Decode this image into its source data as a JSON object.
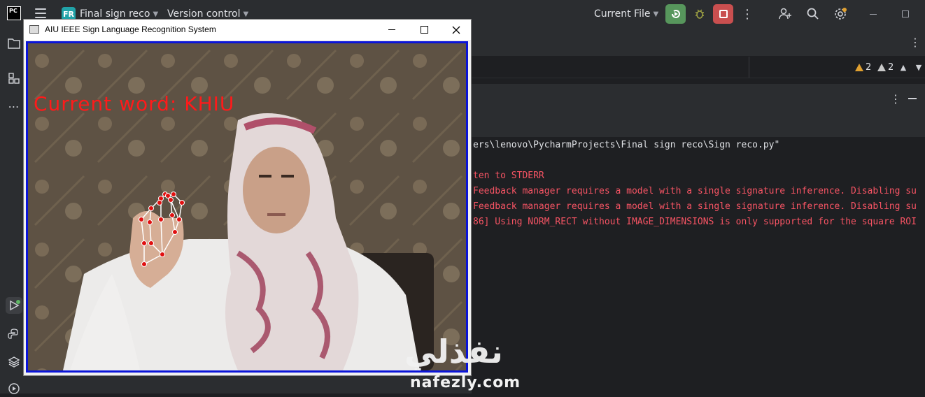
{
  "topbar": {
    "app_logo": "PC",
    "project_badge": "FR",
    "project_name": "Final sign reco",
    "vcs_menu": "Version control",
    "run_config": "Current File"
  },
  "editor": {
    "warnings_1": "2",
    "warnings_2": "2"
  },
  "console": {
    "lines": [
      "ers\\lenovo\\PycharmProjects\\Final sign reco\\Sign reco.py\"",
      "ten to STDERR",
      "Feedback manager requires a model with a single signature inference. Disabling su",
      "Feedback manager requires a model with a single signature inference. Disabling su",
      "86] Using NORM_RECT without IMAGE_DIMENSIONS is only supported for the square ROI"
    ],
    "colors": {
      "path": "#dfe1e5",
      "error": "#f75464"
    }
  },
  "cv_window": {
    "title": "AIU IEEE Sign Language Recognition System",
    "overlay_text": "Current word: KHIU"
  },
  "watermark": {
    "arabic": "نفذلي",
    "latin": "nafezly.com"
  },
  "icons": [
    "folder-icon",
    "structure-icon",
    "more-icon",
    "run-tool-icon",
    "python-console-icon",
    "layers-icon",
    "services-icon",
    "debug-icon",
    "add-user-icon",
    "search-icon",
    "settings-icon"
  ]
}
